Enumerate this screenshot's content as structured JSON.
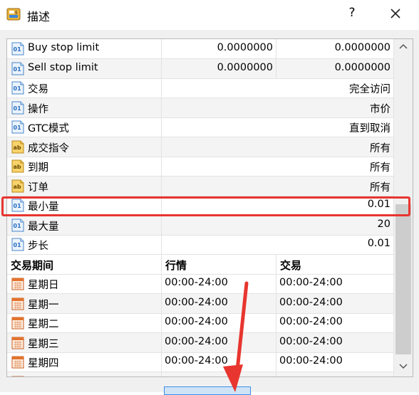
{
  "window": {
    "title": "描述",
    "help_label": "?"
  },
  "properties": [
    {
      "icon": "number-icon",
      "label": "Buy stop limit",
      "value": "0.0000000",
      "value2": "0.0000000"
    },
    {
      "icon": "number-icon",
      "label": "Sell stop limit",
      "value": "0.0000000",
      "value2": "0.0000000"
    },
    {
      "icon": "number-icon",
      "label": "交易",
      "value": "完全访问"
    },
    {
      "icon": "number-icon",
      "label": "操作",
      "value": "市价"
    },
    {
      "icon": "number-icon",
      "label": "GTC模式",
      "value": "直到取消"
    },
    {
      "icon": "text-icon",
      "label": "成交指令",
      "value": "所有"
    },
    {
      "icon": "text-icon",
      "label": "到期",
      "value": "所有"
    },
    {
      "icon": "text-icon",
      "label": "订单",
      "value": "所有"
    },
    {
      "icon": "number-icon",
      "label": "最小量",
      "value": "0.01"
    },
    {
      "icon": "number-icon",
      "label": "最大量",
      "value": "20"
    },
    {
      "icon": "number-icon",
      "label": "步长",
      "value": "0.01"
    }
  ],
  "sessions": {
    "headers": [
      "交易期间",
      "行情",
      "交易"
    ],
    "rows": [
      {
        "day": "星期日",
        "quotes": "00:00-24:00",
        "trade": "00:00-24:00"
      },
      {
        "day": "星期一",
        "quotes": "00:00-24:00",
        "trade": "00:00-24:00"
      },
      {
        "day": "星期二",
        "quotes": "00:00-24:00",
        "trade": "00:00-24:00"
      },
      {
        "day": "星期三",
        "quotes": "00:00-24:00",
        "trade": "00:00-24:00"
      },
      {
        "day": "星期四",
        "quotes": "00:00-24:00",
        "trade": "00:00-24:00"
      }
    ]
  },
  "colors": {
    "highlight": "#e8352f",
    "arrow": "#e8352f"
  }
}
